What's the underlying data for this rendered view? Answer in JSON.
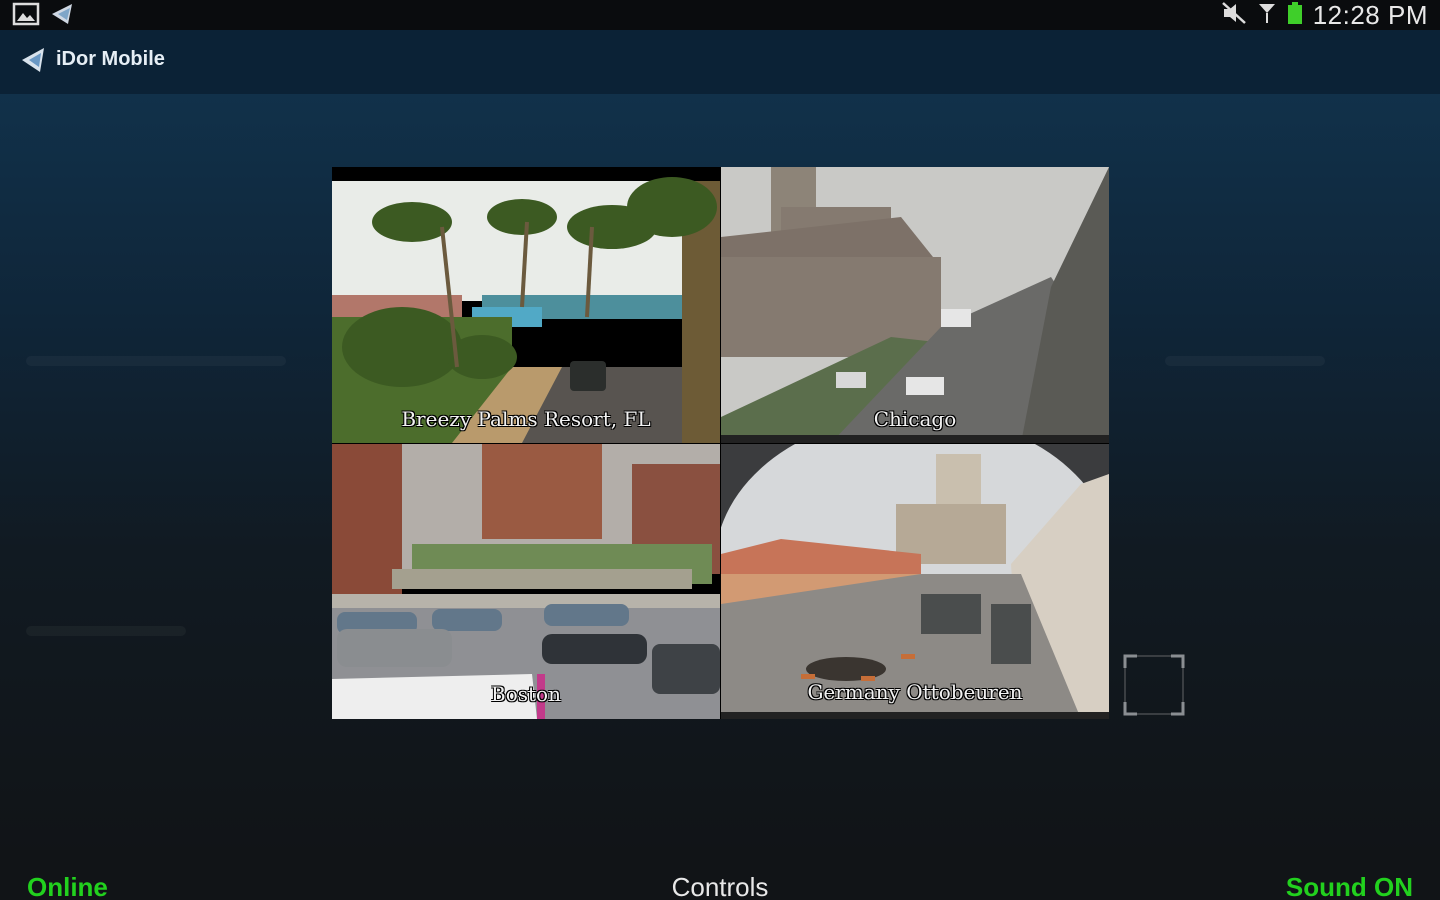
{
  "status_bar": {
    "time": "12:28 PM",
    "icons": [
      "gallery-icon",
      "idor-notification-icon",
      "mute-icon",
      "signal-icon",
      "battery-icon"
    ]
  },
  "action_bar": {
    "title": "iDor Mobile",
    "icon": "idor-logo-icon"
  },
  "cameras": [
    {
      "label": "Breezy Palms Resort, FL"
    },
    {
      "label": "Chicago"
    },
    {
      "label": "Boston"
    },
    {
      "label": "Germany Ottobeuren"
    }
  ],
  "fullscreen": {
    "icon": "fullscreen-frame-icon"
  },
  "bottom_bar": {
    "connection_status": "Online",
    "controls_label": "Controls",
    "sound_status": "Sound ON"
  },
  "colors": {
    "status_green": "#22d11e",
    "action_bar": "#0b2236"
  }
}
